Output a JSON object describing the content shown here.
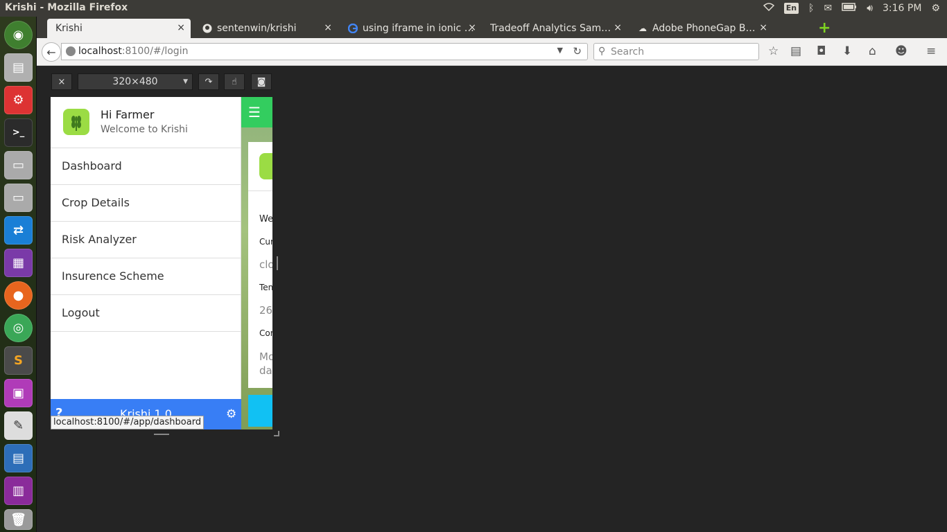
{
  "os_panel": {
    "window_title": "Krishi - Mozilla Firefox",
    "keyboard_layout": "En",
    "clock": "3:16 PM",
    "tray_icons": [
      "wifi-icon",
      "keyboard-icon",
      "bluetooth-icon",
      "mail-icon",
      "battery-icon",
      "volume-icon",
      "settings-gear-icon"
    ]
  },
  "launcher": {
    "apps": [
      "ubuntu-dash",
      "files-archive",
      "system-settings",
      "terminal",
      "disk-drive",
      "disk-drive-2",
      "teamviewer",
      "video-app",
      "firefox",
      "chrome",
      "sublime-text",
      "remote-desktop",
      "text-editor",
      "libreoffice-impress",
      "workspace-switcher",
      "trash"
    ]
  },
  "browser": {
    "tabs": [
      {
        "label": "Krishi",
        "active": true,
        "icon": "none"
      },
      {
        "label": "sentenwin/krishi",
        "active": false,
        "icon": "github-icon"
      },
      {
        "label": "using iframe in ionic …",
        "active": false,
        "icon": "google-icon"
      },
      {
        "label": "Tradeoff Analytics Sam…",
        "active": false,
        "icon": "none"
      },
      {
        "label": "Adobe PhoneGap B…",
        "active": false,
        "icon": "phonegap-icon"
      }
    ],
    "url_host": "localhost",
    "url_path": ":8100/#/login",
    "search_placeholder": "Search"
  },
  "responsive_toolbar": {
    "close": "×",
    "size_option": "320×480"
  },
  "app": {
    "side_menu": {
      "greeting": "Hi Farmer",
      "subtitle": "Welcome to Krishi",
      "items": [
        {
          "label": "Dashboard"
        },
        {
          "label": "Crop Details"
        },
        {
          "label": "Risk Analyzer"
        },
        {
          "label": "Insurence Scheme"
        },
        {
          "label": "Logout"
        }
      ],
      "footer_help": "?",
      "footer_version": "Krishi 1.0"
    },
    "page_card": {
      "line1": "We",
      "line2": "Cur",
      "line3": "clo",
      "line4": "Ten",
      "line5": "26",
      "line6": "Cor",
      "line7a": "Mo",
      "line7b": "da"
    }
  },
  "status_tooltip": "localhost:8100/#/app/dashboard",
  "colors": {
    "header_green": "#33cd5f",
    "footer_blue": "#387ef5",
    "card_button_cyan": "#11c1f3",
    "logo_green": "#9bdc44"
  }
}
